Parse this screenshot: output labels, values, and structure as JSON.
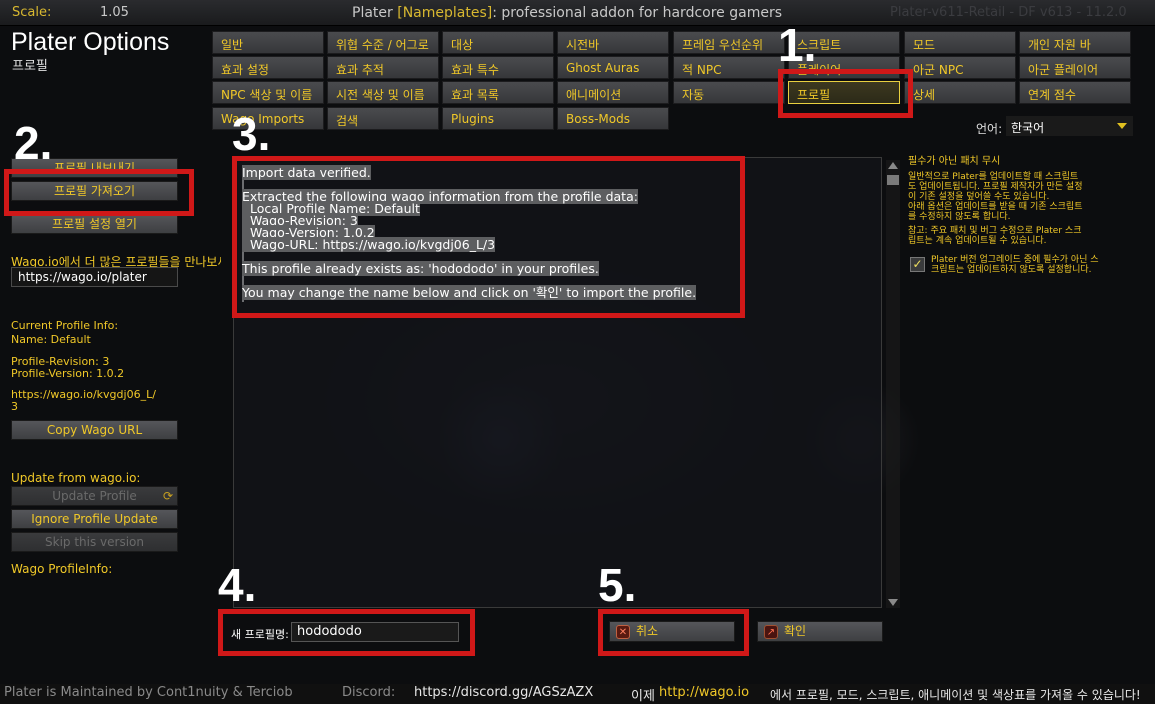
{
  "titlebar": {
    "scale_label": "Scale:",
    "scale_value": "1.05",
    "title_prefix": "Plater ",
    "title_bracket": "[Nameplates]",
    "title_suffix": ": professional addon for hardcore gamers",
    "version": "Plater-v611-Retail - DF v613 - 11.2.0"
  },
  "app": {
    "title": "Plater Options",
    "subtitle": "프로필"
  },
  "tabs": [
    "일반",
    "위협 수준 / 어그로",
    "대상",
    "시전바",
    "프레임 우선순위",
    "스크립트",
    "모드",
    "개인 자원 바",
    "효과 설정",
    "효과 추적",
    "효과 특수",
    "Ghost Auras",
    "적 NPC",
    "플레이어",
    "아군 NPC",
    "아군 플레이어",
    "NPC 색상 및 이름",
    "시전 색상 및 이름",
    "효과 목록",
    "애니메이션",
    "자동",
    "프로필",
    "상세",
    "연계 점수",
    "Wago Imports",
    "검색",
    "Plugins",
    "Boss-Mods"
  ],
  "annotations": {
    "step1": "1.",
    "step2": "2.",
    "step3": "3.",
    "step4": "4.",
    "step5": "5."
  },
  "language": {
    "label": "언어:",
    "value": "한국어"
  },
  "left": {
    "export_button": "프로필 내보내기",
    "import_button": "프로필 가져오기",
    "open_settings_button": "프로필 설정 열기",
    "wago_promo": "Wago.io에서 더 많은 프로필들을 만나보세요!",
    "wago_url": "https://wago.io/plater",
    "current_info_title": "Current Profile Info:",
    "current_name": "Name: Default",
    "profile_revision": "Profile-Revision: 3",
    "profile_version": "Profile-Version: 1.0.2",
    "profile_url_1": "https://wago.io/kvgdj06_L/",
    "profile_url_2": "3",
    "copy_url_button": "Copy Wago URL",
    "update_from": "Update from wago.io:",
    "update_button": "Update Profile",
    "ignore_button": "Ignore Profile Update",
    "skip_button": "Skip this version",
    "wago_profile_info": "Wago ProfileInfo:"
  },
  "import": {
    "line1": "Import data verified.",
    "line2": "Extracted the following wago information from the profile data:",
    "line3": "  Local Profile Name: Default",
    "line4": "  Wago-Revision: 3",
    "line5": "  Wago-Version: 1.0.2",
    "line6": "  Wago-URL: https://wago.io/kvgdj06_L/3",
    "line7": "This profile already exists as: 'hodododo' in your profiles.",
    "line8": "You may change the name below and click on '확인' to import the profile."
  },
  "right": {
    "ignore_title": "필수가 아닌 패치 무시",
    "desc1": "일반적으로 Plater를 업데이트할 때 스크립트",
    "desc2": "도 업데이트됩니다. 프로필 제작자가 만든 설정",
    "desc3": "이 기존 설정을 덮어쓸 수도 있습니다.",
    "desc4": "아래 옵션은 업데이트를 받을 때 기존 스크립트",
    "desc5": "를 수정하지 않도록 합니다.",
    "note1": "참고: 주요 패치 및 버그 수정으로 Plater 스크",
    "note2": "립트는 계속 업데이트될 수 있습니다.",
    "check_label1": "Plater 버전 업그레이드 중에 필수가 아닌 스",
    "check_label2": "크립트는 업데이트하지 않도록 설정합니다.",
    "check_mark": "✓"
  },
  "bottom": {
    "new_name_label": "새 프로필명:",
    "new_name_value": "hodododo",
    "cancel_label": "취소",
    "confirm_label": "확인"
  },
  "footer": {
    "maintained": "Plater is Maintained by Cont1nuity & Terciob",
    "discord_label": "Discord:",
    "discord_url": "https://discord.gg/AGSzAZX",
    "promo_prefix": "이제",
    "promo_link": "http://wago.io",
    "promo_suffix": "에서 프로필, 모드, 스크립트, 애니메이션 및 색상표를 가져올 수 있습니다!"
  },
  "colors": {
    "accent": "#f0c828",
    "annotation": "#d01818"
  }
}
